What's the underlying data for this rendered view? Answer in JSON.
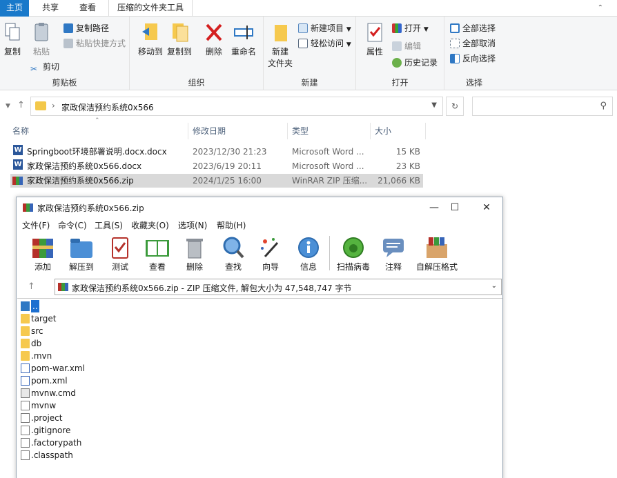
{
  "ribbon_tabs": [
    "主页",
    "共享",
    "查看",
    "压缩的文件夹工具"
  ],
  "ribbon": {
    "clipboard": {
      "copy": "复制",
      "paste": "粘贴",
      "copy_path": "复制路径",
      "paste_shortcut": "粘贴快捷方式",
      "cut": "剪切",
      "label": "剪贴板"
    },
    "organize": {
      "move_to": "移动到",
      "copy_to": "复制到",
      "delete": "删除",
      "rename": "重命名",
      "label": "组织"
    },
    "new": {
      "new_folder_l1": "新建",
      "new_folder_l2": "文件夹",
      "new_item": "新建项目",
      "easy_access": "轻松访问",
      "label": "新建"
    },
    "open": {
      "properties": "属性",
      "open": "打开",
      "edit": "编辑",
      "history": "历史记录",
      "label": "打开"
    },
    "select": {
      "select_all": "全部选择",
      "select_none": "全部取消",
      "invert": "反向选择",
      "label": "选择"
    }
  },
  "address": {
    "path": "家政保洁预约系统0x566"
  },
  "columns": {
    "name": "名称",
    "modified": "修改日期",
    "type": "类型",
    "size": "大小"
  },
  "files": [
    {
      "name": "Springboot环境部署说明.docx.docx",
      "modified": "2023/12/30 21:23",
      "type": "Microsoft Word ...",
      "size": "15 KB"
    },
    {
      "name": "家政保洁预约系统0x566.docx",
      "modified": "2023/6/19 20:11",
      "type": "Microsoft Word ...",
      "size": "23 KB"
    },
    {
      "name": "家政保洁预约系统0x566.zip",
      "modified": "2024/1/25 16:00",
      "type": "WinRAR ZIP 压缩...",
      "size": "21,066 KB"
    }
  ],
  "winrar": {
    "title": "家政保洁预约系统0x566.zip",
    "menu": [
      "文件(F)",
      "命令(C)",
      "工具(S)",
      "收藏夹(O)",
      "选项(N)",
      "帮助(H)"
    ],
    "toolbar": [
      "添加",
      "解压到",
      "测试",
      "查看",
      "删除",
      "查找",
      "向导",
      "信息",
      "扫描病毒",
      "注释",
      "自解压格式"
    ],
    "path_text": "家政保洁预约系统0x566.zip - ZIP 压缩文件, 解包大小为 47,548,747 字节",
    "items": [
      "..",
      "target",
      "src",
      "db",
      ".mvn",
      "pom-war.xml",
      "pom.xml",
      "mvnw.cmd",
      "mvnw",
      ".project",
      ".gitignore",
      ".factorypath",
      ".classpath"
    ]
  },
  "colors": {
    "ribbon_accent": "#1979ca",
    "selection": "#d9d9d9",
    "folder": "#f6c94e"
  }
}
